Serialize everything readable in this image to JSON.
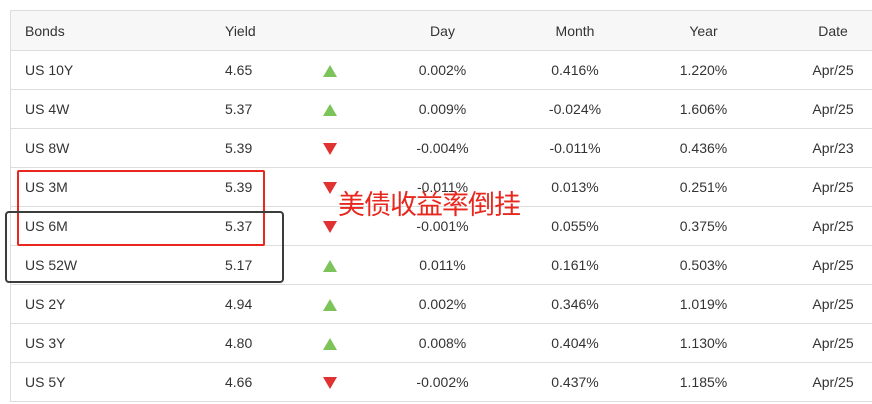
{
  "table": {
    "headers": {
      "bonds": "Bonds",
      "yield": "Yield",
      "day": "Day",
      "month": "Month",
      "year": "Year",
      "date": "Date"
    },
    "rows": [
      {
        "bond": "US 10Y",
        "yield": "4.65",
        "direction": "up",
        "day": "0.002%",
        "month": "0.416%",
        "year": "1.220%",
        "date": "Apr/25"
      },
      {
        "bond": "US 4W",
        "yield": "5.37",
        "direction": "up",
        "day": "0.009%",
        "month": "-0.024%",
        "year": "1.606%",
        "date": "Apr/25"
      },
      {
        "bond": "US 8W",
        "yield": "5.39",
        "direction": "down",
        "day": "-0.004%",
        "month": "-0.011%",
        "year": "0.436%",
        "date": "Apr/23"
      },
      {
        "bond": "US 3M",
        "yield": "5.39",
        "direction": "down",
        "day": "-0.011%",
        "month": "0.013%",
        "year": "0.251%",
        "date": "Apr/25"
      },
      {
        "bond": "US 6M",
        "yield": "5.37",
        "direction": "down",
        "day": "-0.001%",
        "month": "0.055%",
        "year": "0.375%",
        "date": "Apr/25"
      },
      {
        "bond": "US 52W",
        "yield": "5.17",
        "direction": "up",
        "day": "0.011%",
        "month": "0.161%",
        "year": "0.503%",
        "date": "Apr/25"
      },
      {
        "bond": "US 2Y",
        "yield": "4.94",
        "direction": "up",
        "day": "0.002%",
        "month": "0.346%",
        "year": "1.019%",
        "date": "Apr/25"
      },
      {
        "bond": "US 3Y",
        "yield": "4.80",
        "direction": "up",
        "day": "0.008%",
        "month": "0.404%",
        "year": "1.130%",
        "date": "Apr/25"
      },
      {
        "bond": "US 5Y",
        "yield": "4.66",
        "direction": "down",
        "day": "-0.002%",
        "month": "0.437%",
        "year": "1.185%",
        "date": "Apr/25"
      }
    ]
  },
  "annotation": {
    "text": "美债收益率倒挂",
    "color": "#e8281e"
  },
  "colors": {
    "up": "#7cc35a",
    "down": "#e03232",
    "highlight_box_red": "#e8281e",
    "highlight_box_black": "#3c3c3c"
  }
}
